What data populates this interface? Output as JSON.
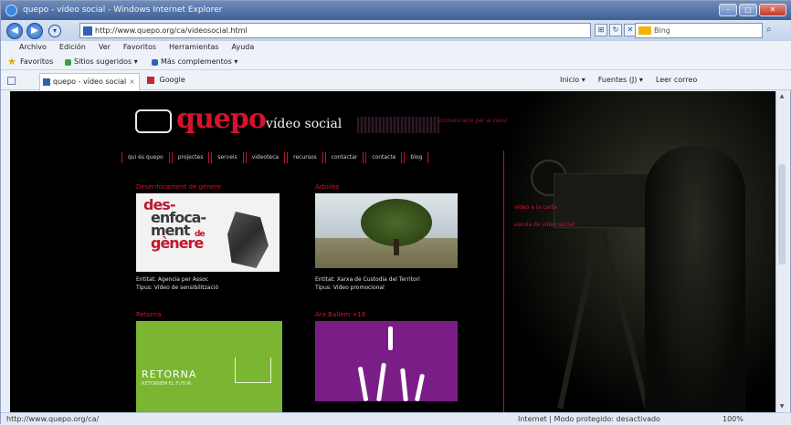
{
  "window": {
    "title": "quepo - vídeo social - Windows Internet Explorer",
    "controls": [
      "minimize",
      "maximize",
      "close"
    ]
  },
  "address_bar": {
    "url": "http://www.quepo.org/ca/videosocial.html",
    "search_placeholder": "Bing"
  },
  "menu": [
    "Archivo",
    "Edición",
    "Ver",
    "Favoritos",
    "Herramientas",
    "Ayuda"
  ],
  "favorites_bar": {
    "label": "Favoritos",
    "items": [
      "Sitios sugeridos ▾",
      "Más complementos ▾"
    ]
  },
  "tabs": {
    "active": "quepo - vídeo social",
    "other": "Google"
  },
  "commands": [
    "Inicio ▾",
    "Fuentes (J) ▾",
    "Leer correo"
  ],
  "site": {
    "logo_word": "quepo",
    "logo_sub": "vídeo social",
    "tagline": "comunicació per al canvi",
    "nav": [
      "qui és quepo",
      "projectes",
      "serveis",
      "videoteca",
      "recursos",
      "contactar",
      "contacte",
      "blog"
    ],
    "side_links": [
      "vídeo a la carta",
      "escola de vídeo social"
    ],
    "items": [
      {
        "title": "Desenfocament de gènere",
        "thumb_words": [
          "des-",
          "enfoca-",
          "ment",
          "de",
          "gènere"
        ],
        "caption1": "Entitat: Agencia per Assoc",
        "caption2": "Tipus: Vídeo de sensibilització"
      },
      {
        "title": "Arbolés",
        "caption1": "Entitat: Xarxa de Custodia del Territori",
        "caption2": "Tipus: Vídeo promocional"
      },
      {
        "title": "Retorna",
        "thumb_text": "RETORNA",
        "thumb_sub": "RETORNEM EL FUTUR"
      },
      {
        "title": "Ara Ballem +18"
      }
    ]
  },
  "status": {
    "left": "http://www.quepo.org/ca/",
    "middle": "Internet | Modo protegido: desactivado",
    "zoom": "100%"
  },
  "colors": {
    "brand_red": "#d4132d",
    "page_bg": "#000000",
    "retorna_green": "#7ab631",
    "bai_purple": "#7a1d86"
  }
}
